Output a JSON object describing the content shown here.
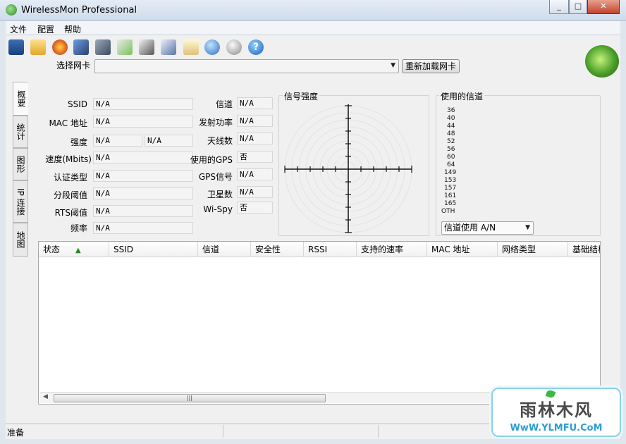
{
  "window": {
    "title": "WirelessMon Professional",
    "min": "_",
    "max": "□",
    "close": "✕"
  },
  "menu": [
    "文件",
    "配置",
    "帮助"
  ],
  "toolbar": {
    "icons": [
      "save-icon",
      "open-folder-icon",
      "record-icon",
      "network-adapter-icon",
      "network-config-icon",
      "print-go-icon",
      "printer-icon",
      "check-print-icon",
      "clipboard-icon",
      "globe-settings-icon",
      "chat-info-icon",
      "help-icon"
    ]
  },
  "adapter": {
    "label": "选择网卡",
    "value": "",
    "reload_label": "重新加载网卡"
  },
  "tabs": [
    "概要",
    "统计",
    "图形",
    "IP 连接",
    "地图"
  ],
  "fields": {
    "ssid": {
      "label": "SSID",
      "value": "N/A"
    },
    "mac": {
      "label": "MAC 地址",
      "value": "N/A"
    },
    "strength": {
      "label": "强度",
      "value1": "N/A",
      "value2": "N/A"
    },
    "speed": {
      "label": "速度(Mbits)",
      "value": "N/A"
    },
    "auth": {
      "label": "认证类型",
      "value": "N/A"
    },
    "frag": {
      "label": "分段阈值",
      "value": "N/A"
    },
    "rts": {
      "label": "RTS阈值",
      "value": "N/A"
    },
    "freq": {
      "label": "频率",
      "value": "N/A"
    },
    "channel": {
      "label": "信道",
      "value": "N/A"
    },
    "txpower": {
      "label": "发射功率",
      "value": "N/A"
    },
    "antenna": {
      "label": "天线数",
      "value": "N/A"
    },
    "gps_used": {
      "label": "使用的GPS",
      "value": "否"
    },
    "gps_signal": {
      "label": "GPS信号",
      "value": "N/A"
    },
    "satellites": {
      "label": "卫星数",
      "value": "N/A"
    },
    "wispy": {
      "label": "Wi-Spy",
      "value": "否"
    }
  },
  "signal": {
    "title": "信号强度"
  },
  "channels": {
    "title": "使用的信道",
    "list": [
      "36",
      "40",
      "44",
      "48",
      "52",
      "56",
      "60",
      "64",
      "149",
      "153",
      "157",
      "161",
      "165",
      "OTH"
    ],
    "select_value": "信道使用 A/N"
  },
  "table": {
    "columns": [
      "状态",
      "SSID",
      "信道",
      "安全性",
      "RSSI",
      "支持的速率",
      "MAC 地址",
      "网络类型",
      "基础结构"
    ],
    "rows": []
  },
  "status": {
    "text": "准备"
  },
  "watermark": {
    "text": "雨林木风",
    "url": "WwW.YLMFU.CoM"
  }
}
